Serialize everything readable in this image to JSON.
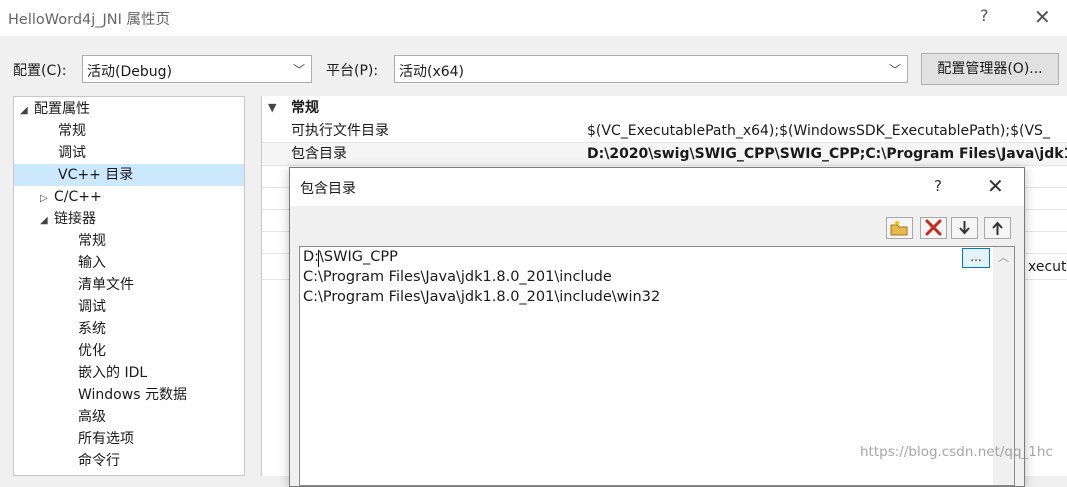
{
  "window": {
    "title": "HelloWord4j_JNI 属性页",
    "help": "?",
    "close": "✕"
  },
  "config": {
    "config_label": "配置(C):",
    "config_value": "活动(Debug)",
    "platform_label": "平台(P):",
    "platform_value": "活动(x64)",
    "manager_button": "配置管理器(O)..."
  },
  "tree": {
    "items": [
      {
        "label": "配置属性",
        "twisty": "◢"
      },
      {
        "label": "常规",
        "twisty": ""
      },
      {
        "label": "调试",
        "twisty": ""
      },
      {
        "label": "VC++ 目录",
        "twisty": ""
      },
      {
        "label": "C/C++",
        "twisty": "▷"
      },
      {
        "label": "链接器",
        "twisty": "◢"
      },
      {
        "label": "常规",
        "twisty": ""
      },
      {
        "label": "输入",
        "twisty": ""
      },
      {
        "label": "清单文件",
        "twisty": ""
      },
      {
        "label": "调试",
        "twisty": ""
      },
      {
        "label": "系统",
        "twisty": ""
      },
      {
        "label": "优化",
        "twisty": ""
      },
      {
        "label": "嵌入的 IDL",
        "twisty": ""
      },
      {
        "label": "Windows 元数据",
        "twisty": ""
      },
      {
        "label": "高级",
        "twisty": ""
      },
      {
        "label": "所有选项",
        "twisty": ""
      },
      {
        "label": "命令行",
        "twisty": ""
      }
    ]
  },
  "grid": {
    "section": "常规",
    "rows": [
      {
        "key": "可执行文件目录",
        "value": "$(VC_ExecutablePath_x64);$(WindowsSDK_ExecutablePath);$(VS_"
      },
      {
        "key": "包含目录",
        "value": "D:\\2020\\swig\\SWIG_CPP\\SWIG_CPP;C:\\Program Files\\Java\\jdk1"
      }
    ],
    "clipped_text": "xecut"
  },
  "dialog": {
    "title": "包含目录",
    "help": "?",
    "close": "✕",
    "lines": [
      "D:\\SWIG_CPP",
      "C:\\Program Files\\Java\\jdk1.8.0_201\\include",
      "C:\\Program Files\\Java\\jdk1.8.0_201\\include\\win32"
    ],
    "browse_button": "..."
  },
  "watermark": "https://blog.csdn.net/qq_1hc",
  "colors": {
    "selection": "#cce8ff",
    "delete_red": "#c42b1c",
    "folder_yellow": "#e8b84a",
    "focus_blue": "#0078d7"
  }
}
